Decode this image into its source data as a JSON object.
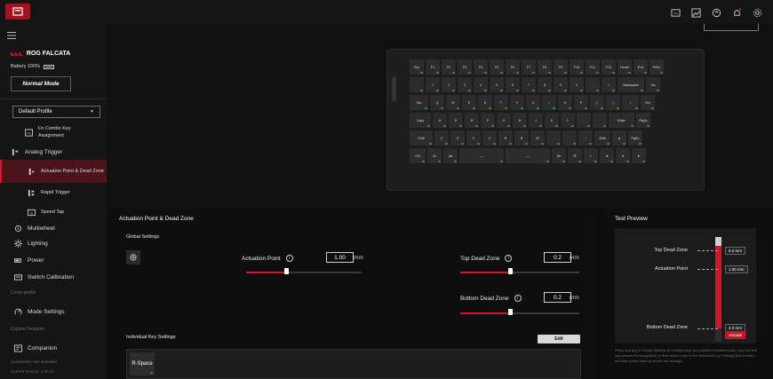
{
  "topbar": {
    "icons": [
      "keyboard-icon",
      "photo-icon",
      "sync-icon",
      "bell-icon",
      "settings-icon"
    ]
  },
  "sidebar": {
    "device_name": "ROG FALCATA",
    "battery": "Battery 100%",
    "mode_button": "Normal Mode",
    "profile": "Default Profile",
    "items": [
      {
        "label": "Fn Combo Key Assignment",
        "icon": "fn-icon"
      },
      {
        "label": "Analog Trigger",
        "icon": "analog-icon"
      },
      {
        "label": "Actuation Point & Dead Zone",
        "icon": "actuation-icon"
      },
      {
        "label": "Rapid Trigger",
        "icon": "rapid-icon"
      },
      {
        "label": "Speed Tap",
        "icon": "speedtap-icon"
      },
      {
        "label": "Multiwheel",
        "icon": "wheel-icon"
      },
      {
        "label": "Lighting",
        "icon": "light-icon"
      },
      {
        "label": "Power",
        "icon": "power-icon"
      },
      {
        "label": "Switch Calibration",
        "icon": "calibration-icon"
      },
      {
        "label": "Mode Settings",
        "icon": "mode-icon"
      },
      {
        "label": "Companion",
        "icon": "companion-icon"
      }
    ],
    "section_cross": "Cross-profile",
    "section_explore": "Explore Features",
    "footer_status": "Companion: Not activated",
    "footer_version": "Current Version: 1.00.41"
  },
  "keyboard": {
    "rows": [
      [
        "Esc",
        "F1",
        "F2",
        "F3",
        "F4",
        "F5",
        "F6",
        "F7",
        "F8",
        "F9",
        "F10",
        "F11",
        "F12",
        "Home",
        "End",
        "PrtSc"
      ],
      [
        "`",
        "1",
        "2",
        "3",
        "4",
        "5",
        "6",
        "7",
        "8",
        "9",
        "0",
        "-",
        "=",
        "Backspace",
        "Ins"
      ],
      [
        "Tab",
        "Q",
        "W",
        "E",
        "R",
        "T",
        "Y",
        "U",
        "I",
        "O",
        "P",
        "[",
        "]",
        "\\",
        "Del"
      ],
      [
        "Caps",
        "A",
        "S",
        "D",
        "F",
        "G",
        "H",
        "J",
        "K",
        "L",
        ";",
        "'",
        "Enter",
        "PgUp"
      ],
      [
        "Shift",
        "Z",
        "X",
        "C",
        "V",
        "B",
        "N",
        "M",
        ",",
        ".",
        "/",
        "Shift",
        "▲",
        "PgDn"
      ],
      [
        "Ctrl",
        "⊞",
        "Alt",
        "—",
        "—",
        "Alt",
        "☰",
        "◐",
        "◄",
        "▼",
        "►"
      ]
    ]
  },
  "main": {
    "title": "Actuation Point & Dead Zone",
    "global_settings": "Global Settings",
    "actuation_label": "Actuation Point",
    "actuation_value": "1.00",
    "actuation_fraction": 0.35,
    "top_dead_label": "Top Dead Zone",
    "top_dead_value": "0.2",
    "top_dead_fraction": 0.42,
    "bottom_dead_label": "Bottom Dead Zone",
    "bottom_dead_value": "0.2",
    "bottom_dead_fraction": 0.42,
    "unit": "mm",
    "individual_title": "Individual Key Settings",
    "edit_label": "Edit",
    "individual_key": "R-Space"
  },
  "test": {
    "title": "Test Preview",
    "top_dead_label": "Top Dead Zone",
    "top_dead_value": "0.2 mm",
    "actuation_label": "Actuation Point",
    "actuation_value": "1.00 mm",
    "bottom_dead_label": "Bottom Dead Zone",
    "bottom_dead_value": "3.3 mm",
    "bottom_badge": "Actuate",
    "note": "Press any key in Global Settings (if multiple keys are pressed simultaneously, only the first key pressed is recognized) or first select a key in the Individual Key Settings (red border) and then press that key to test the settings."
  },
  "colors": {
    "accent": "#d8132a",
    "panel": "#1b1b1b"
  }
}
